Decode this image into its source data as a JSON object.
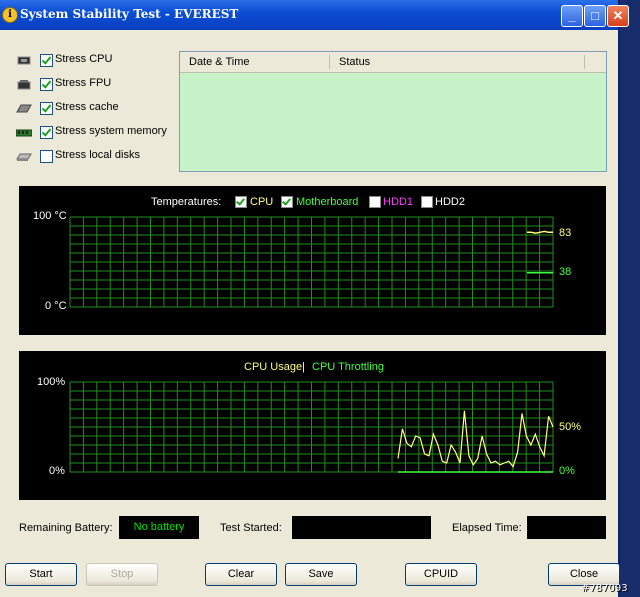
{
  "window": {
    "title": "System Stability Test - EVEREST"
  },
  "title_buttons": {
    "minimize": "_",
    "maximize": "□",
    "close": "✕"
  },
  "stress_options": [
    {
      "label": "Stress CPU",
      "checked": true
    },
    {
      "label": "Stress FPU",
      "checked": true
    },
    {
      "label": "Stress cache",
      "checked": true
    },
    {
      "label": "Stress system memory",
      "checked": true
    },
    {
      "label": "Stress local disks",
      "checked": false
    }
  ],
  "status_table": {
    "col_date": "Date & Time",
    "col_status": "Status"
  },
  "temperature_chart": {
    "legend_title": "Temperatures:",
    "legend_items": [
      {
        "label": "CPU",
        "checked": true,
        "color": "#ffff80"
      },
      {
        "label": "Motherboard",
        "checked": true,
        "color": "#40ff40"
      },
      {
        "label": "HDD1",
        "checked": false,
        "color": "#ff40ff"
      },
      {
        "label": "HDD2",
        "checked": false,
        "color": "#ffffff"
      }
    ]
  },
  "usage_chart": {
    "legend_usage": "CPU Usage",
    "legend_sep": "|",
    "legend_throttle": "CPU Throttling",
    "usage_color": "#ffff80",
    "throttle_color": "#40ff40"
  },
  "chart_data": [
    {
      "type": "line",
      "title": "Temperatures:",
      "ylim": [
        0,
        100
      ],
      "y_tick_labels": [
        "100 °C",
        "0 °C"
      ],
      "series": [
        {
          "name": "CPU",
          "current_value": 83,
          "current_label": "83",
          "values": [
            83,
            83,
            82,
            83,
            84,
            83,
            83
          ]
        },
        {
          "name": "Motherboard",
          "current_value": 38,
          "current_label": "38",
          "values": [
            38,
            38,
            38,
            38,
            38,
            38,
            38
          ]
        }
      ],
      "grid": true
    },
    {
      "type": "line",
      "title": "CPU Usage | CPU Throttling",
      "ylim": [
        0,
        100
      ],
      "y_tick_labels": [
        "100%",
        "0%"
      ],
      "series": [
        {
          "name": "CPU Usage",
          "current_label": "50%",
          "values": [
            15,
            48,
            32,
            28,
            40,
            38,
            20,
            18,
            42,
            30,
            12,
            10,
            30,
            22,
            10,
            68,
            18,
            8,
            15,
            40,
            20,
            10,
            12,
            8,
            10,
            12,
            6,
            22,
            65,
            40,
            30,
            42,
            28,
            18,
            62,
            50
          ]
        },
        {
          "name": "CPU Throttling",
          "current_label": "0%",
          "values": [
            0,
            0
          ]
        }
      ],
      "grid": true
    }
  ],
  "fields": {
    "battery_label": "Remaining Battery:",
    "battery_value": "No battery",
    "started_label": "Test Started:",
    "started_value": "",
    "elapsed_label": "Elapsed Time:",
    "elapsed_value": ""
  },
  "buttons": {
    "start": "Start",
    "stop": "Stop",
    "clear": "Clear",
    "save": "Save",
    "cpuid": "CPUID",
    "close": "Close"
  },
  "watermark": "#787093"
}
